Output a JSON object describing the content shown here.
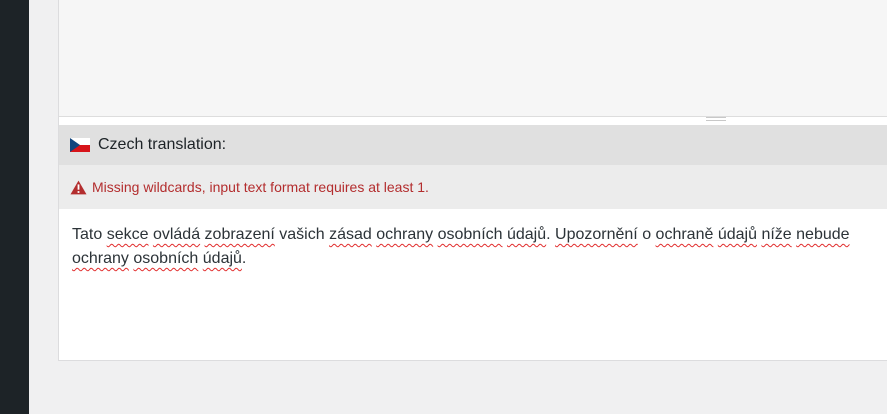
{
  "translation": {
    "language": "Czech translation:",
    "warning": "Missing wildcards, input text format requires at least 1.",
    "text": {
      "line1": [
        "Tato ",
        "sekce",
        " ",
        "ovládá",
        " ",
        "zobrazení",
        " vašich ",
        "zásad",
        " ",
        "ochrany",
        " ",
        "osobních",
        " ",
        "údajů",
        ". ",
        "Upozornění",
        " o ",
        "ochraně",
        " ",
        "údajů",
        " ",
        "níže",
        " ",
        "nebude"
      ],
      "line2": [
        "ochrany",
        " ",
        "osobních",
        " ",
        "údajů",
        "."
      ]
    }
  },
  "colors": {
    "warning": "#b32d2e",
    "sidebar": "#1d2327"
  },
  "icons": {
    "flag": "czech-flag-icon",
    "warning": "warning-icon"
  }
}
